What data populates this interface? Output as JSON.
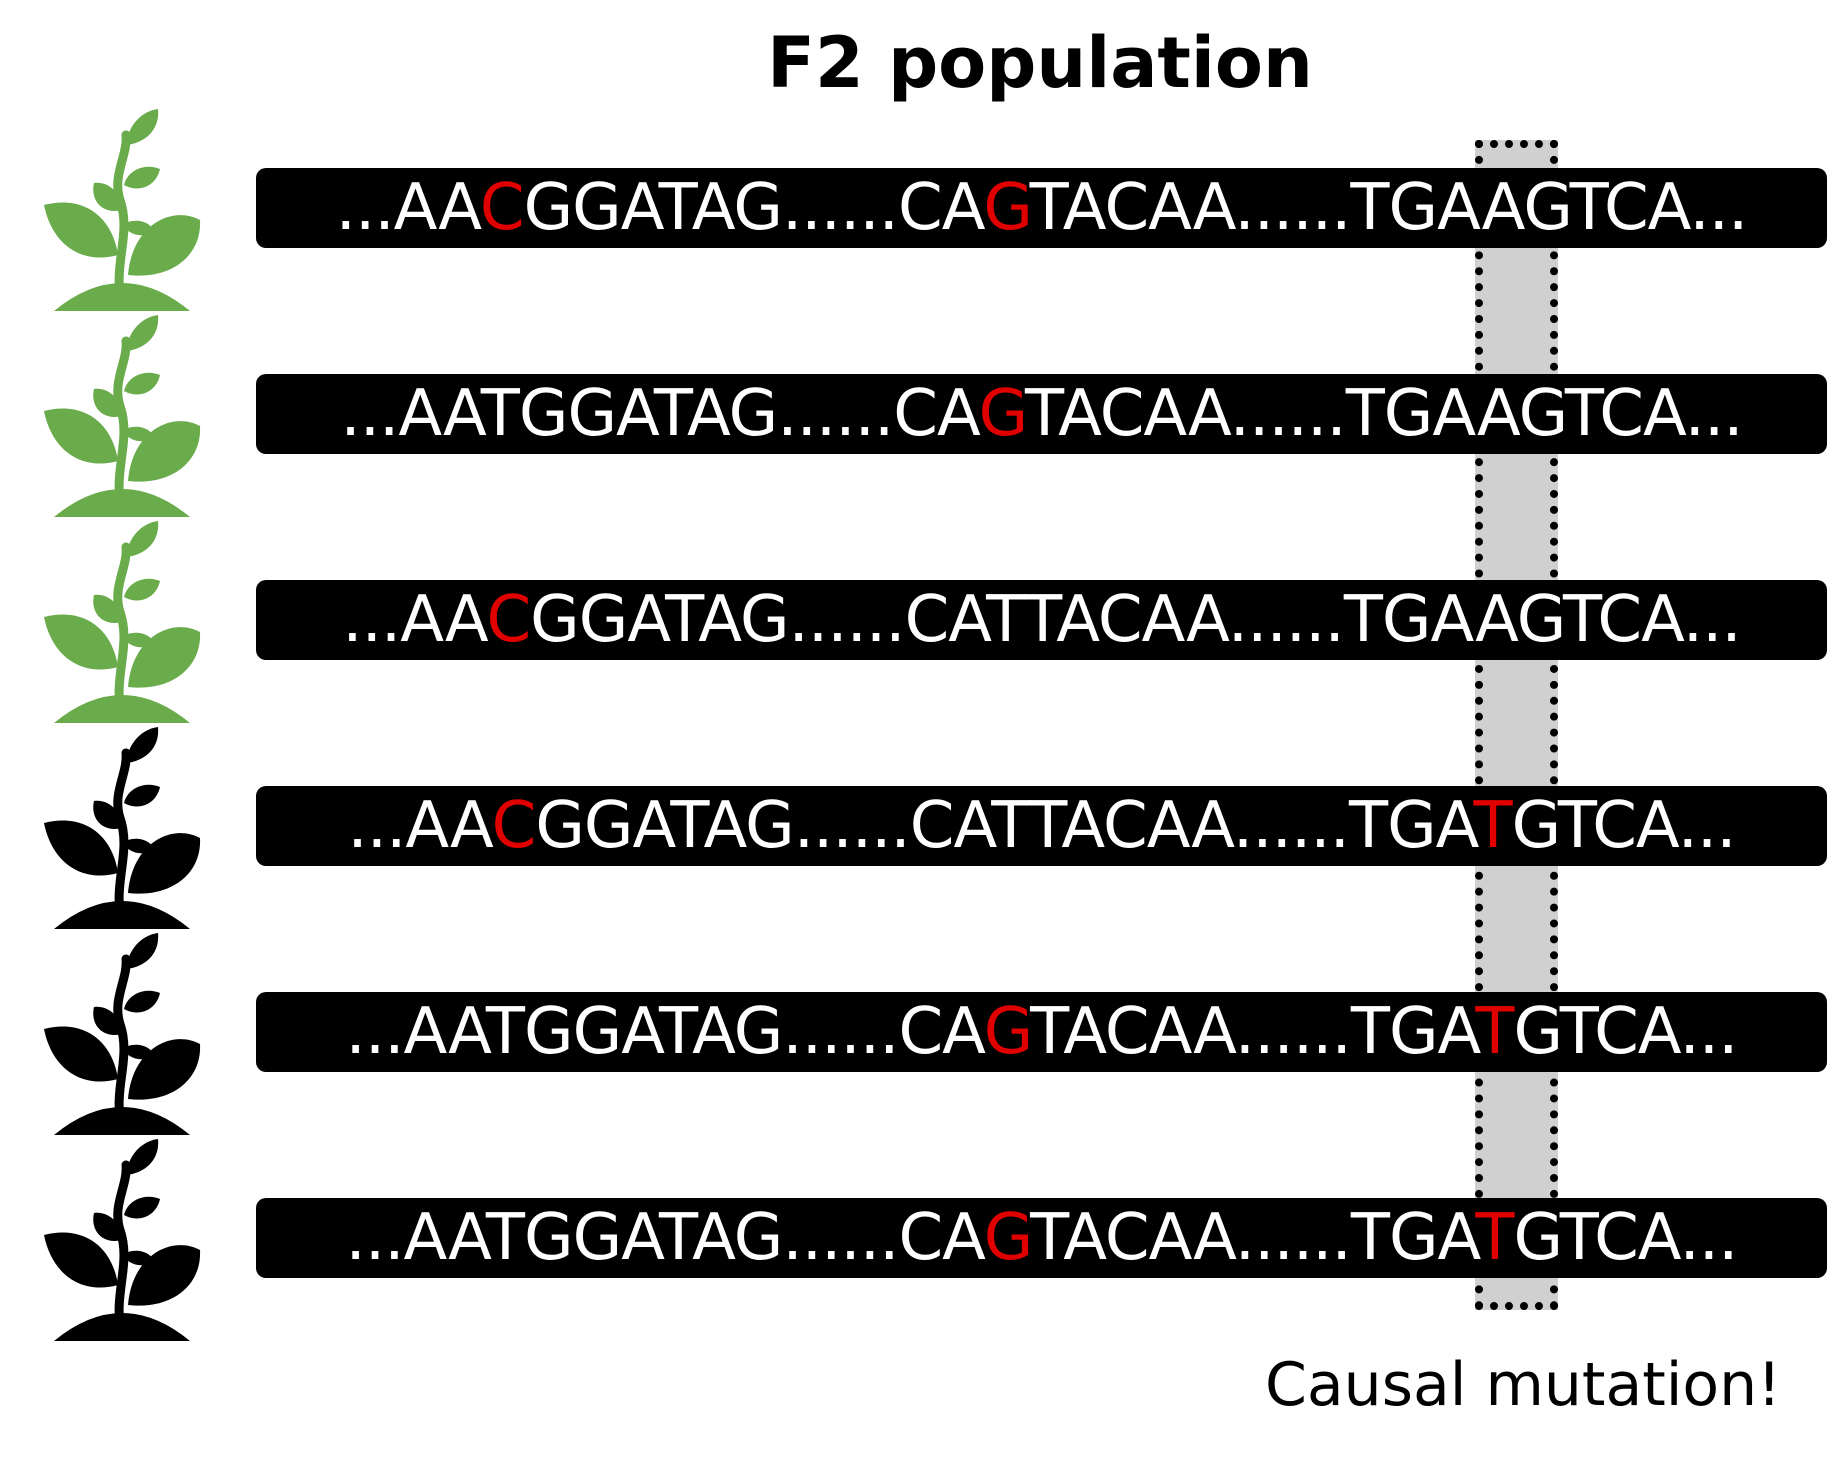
{
  "title": "F2 population",
  "annotation": "Causal mutation!",
  "colors": {
    "wildtype_plant": "#6aac4c",
    "mutant_plant": "#000000",
    "mutation_base": "#e00000",
    "sequence_bar": "#000000",
    "sequence_text": "#ffffff",
    "highlight": "#d0d0d0"
  },
  "rows": [
    {
      "phenotype": "wild-type (green)",
      "sequence": [
        {
          "t": "...AA"
        },
        {
          "t": "C",
          "mut": true
        },
        {
          "t": "GGATAG......CA"
        },
        {
          "t": "G",
          "mut": true
        },
        {
          "t": "TACAA......TGAAGTCA..."
        }
      ]
    },
    {
      "phenotype": "wild-type (green)",
      "sequence": [
        {
          "t": "...AATGGATAG......CA"
        },
        {
          "t": "G",
          "mut": true
        },
        {
          "t": "TACAA......TGAAGTCA..."
        }
      ]
    },
    {
      "phenotype": "wild-type (green)",
      "sequence": [
        {
          "t": "...AA"
        },
        {
          "t": "C",
          "mut": true
        },
        {
          "t": "GGATAG......CATTACAA......TGAAGTCA..."
        }
      ]
    },
    {
      "phenotype": "mutant (black)",
      "sequence": [
        {
          "t": "...AA"
        },
        {
          "t": "C",
          "mut": true
        },
        {
          "t": "GGATAG......CATTACAA......TGA"
        },
        {
          "t": "T",
          "mut": true
        },
        {
          "t": "GTCA..."
        }
      ]
    },
    {
      "phenotype": "mutant (black)",
      "sequence": [
        {
          "t": "...AATGGATAG......CA"
        },
        {
          "t": "G",
          "mut": true
        },
        {
          "t": "TACAA......TGA"
        },
        {
          "t": "T",
          "mut": true
        },
        {
          "t": "GTCA..."
        }
      ]
    },
    {
      "phenotype": "mutant (black)",
      "sequence": [
        {
          "t": "...AATGGATAG......CA"
        },
        {
          "t": "G",
          "mut": true
        },
        {
          "t": "TACAA......TGA"
        },
        {
          "t": "T",
          "mut": true
        },
        {
          "t": "GTCA..."
        }
      ]
    }
  ]
}
